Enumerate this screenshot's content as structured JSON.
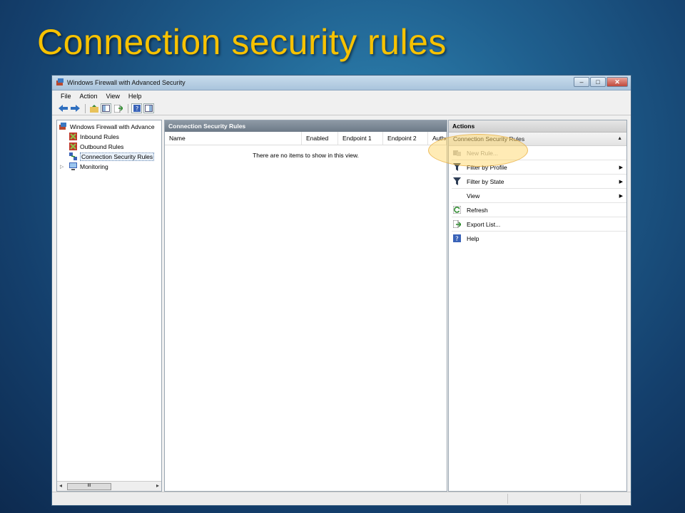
{
  "slide": {
    "title": "Connection security rules"
  },
  "window": {
    "title": "Windows Firewall with Advanced Security",
    "buttons": {
      "minimize": "–",
      "maximize": "□",
      "close": "✕"
    }
  },
  "menu": [
    "File",
    "Action",
    "View",
    "Help"
  ],
  "tree": {
    "root": "Windows Firewall with Advance",
    "items": [
      "Inbound Rules",
      "Outbound Rules",
      "Connection Security Rules",
      "Monitoring"
    ],
    "selected": "Connection Security Rules",
    "scroll_label": "III"
  },
  "center": {
    "header": "Connection Security Rules",
    "columns": [
      "Name",
      "Enabled",
      "Endpoint 1",
      "Endpoint 2",
      "Authe"
    ],
    "empty_message": "There are no items to show in this view."
  },
  "actions": {
    "header": "Actions",
    "section": "Connection Security Rules",
    "items": [
      {
        "label": "New Rule...",
        "icon": "new-rule-icon",
        "disabled": true
      },
      {
        "label": "Filter by Profile",
        "icon": "filter-icon",
        "submenu": true
      },
      {
        "label": "Filter by State",
        "icon": "filter-icon",
        "submenu": true
      },
      {
        "label": "View",
        "icon": "",
        "submenu": true
      },
      {
        "label": "Refresh",
        "icon": "refresh-icon"
      },
      {
        "label": "Export List...",
        "icon": "export-list-icon"
      },
      {
        "label": "Help",
        "icon": "help-icon"
      }
    ]
  },
  "colors": {
    "slide_title": "#f7c200",
    "pane_header": "#7a8692",
    "highlight": "#ffd25a"
  }
}
